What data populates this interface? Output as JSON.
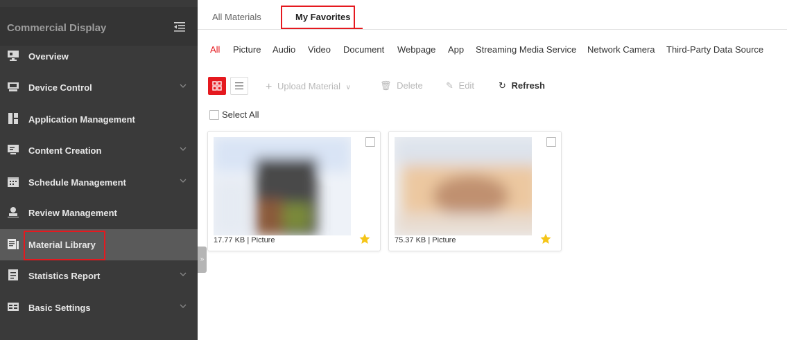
{
  "sidebar": {
    "title": "Commercial Display",
    "items": [
      {
        "label": "Overview",
        "icon": "monitor-icon",
        "chevron": false,
        "active": false
      },
      {
        "label": "Device Control",
        "icon": "device-icon",
        "chevron": true,
        "active": false
      },
      {
        "label": "Application Management",
        "icon": "app-grid-icon",
        "chevron": false,
        "active": false
      },
      {
        "label": "Content Creation",
        "icon": "edit-screen-icon",
        "chevron": true,
        "active": false
      },
      {
        "label": "Schedule Management",
        "icon": "calendar-icon",
        "chevron": true,
        "active": false
      },
      {
        "label": "Review Management",
        "icon": "user-review-icon",
        "chevron": false,
        "active": false
      },
      {
        "label": "Material Library",
        "icon": "library-icon",
        "chevron": false,
        "active": true
      },
      {
        "label": "Statistics Report",
        "icon": "report-icon",
        "chevron": true,
        "active": false
      },
      {
        "label": "Basic Settings",
        "icon": "settings-panel-icon",
        "chevron": true,
        "active": false
      }
    ],
    "expand_glyph": "»"
  },
  "tabs": [
    {
      "label": "All Materials",
      "active": false
    },
    {
      "label": "My Favorites",
      "active": true
    }
  ],
  "filters": [
    "All",
    "Picture",
    "Audio",
    "Video",
    "Document",
    "Webpage",
    "App",
    "Streaming Media Service",
    "Network Camera",
    "Third-Party Data Source"
  ],
  "active_filter": "All",
  "toolbar": {
    "upload_label": "Upload Material",
    "delete_label": "Delete",
    "edit_label": "Edit",
    "refresh_label": "Refresh"
  },
  "select_all_label": "Select All",
  "cards": [
    {
      "meta": "17.77 KB | Picture",
      "favorite": true
    },
    {
      "meta": "75.37 KB | Picture",
      "favorite": true
    }
  ],
  "colors": {
    "accent": "#e5191f",
    "sidebar_bg": "#3a3a3a",
    "sidebar_active": "#5a5a5a",
    "star": "#f5c518"
  }
}
